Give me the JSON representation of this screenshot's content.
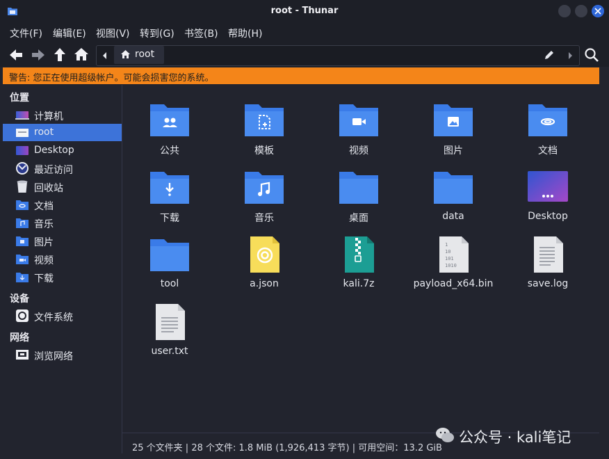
{
  "window": {
    "title": "root - Thunar"
  },
  "menu": [
    {
      "label": "文件(F)"
    },
    {
      "label": "编辑(E)"
    },
    {
      "label": "视图(V)"
    },
    {
      "label": "转到(G)"
    },
    {
      "label": "书签(B)"
    },
    {
      "label": "帮助(H)"
    }
  ],
  "path": {
    "current": "root"
  },
  "warning": "警告: 您正在使用超级帐户。可能会损害您的系统。",
  "sidebar": {
    "places_title": "位置",
    "places": [
      {
        "label": "计算机",
        "icon": "computer-icon"
      },
      {
        "label": "root",
        "icon": "home-folder-icon",
        "selected": true
      },
      {
        "label": "Desktop",
        "icon": "desktop-icon"
      },
      {
        "label": "最近访问",
        "icon": "recent-icon"
      },
      {
        "label": "回收站",
        "icon": "trash-icon"
      },
      {
        "label": "文档",
        "icon": "documents-folder-icon"
      },
      {
        "label": "音乐",
        "icon": "music-folder-icon"
      },
      {
        "label": "图片",
        "icon": "pictures-folder-icon"
      },
      {
        "label": "视频",
        "icon": "videos-folder-icon"
      },
      {
        "label": "下载",
        "icon": "downloads-folder-icon"
      }
    ],
    "devices_title": "设备",
    "devices": [
      {
        "label": "文件系统",
        "icon": "drive-icon"
      }
    ],
    "network_title": "网络",
    "network": [
      {
        "label": "浏览网络",
        "icon": "network-icon"
      }
    ]
  },
  "files": [
    {
      "name": "公共",
      "icon": "public-folder-icon"
    },
    {
      "name": "模板",
      "icon": "templates-folder-icon"
    },
    {
      "name": "视频",
      "icon": "videos-folder-icon"
    },
    {
      "name": "图片",
      "icon": "pictures-folder-icon"
    },
    {
      "name": "文档",
      "icon": "documents-folder-icon"
    },
    {
      "name": "下载",
      "icon": "downloads-folder-icon"
    },
    {
      "name": "音乐",
      "icon": "music-folder-icon"
    },
    {
      "name": "桌面",
      "icon": "folder-icon"
    },
    {
      "name": "data",
      "icon": "folder-icon"
    },
    {
      "name": "Desktop",
      "icon": "desktop-icon"
    },
    {
      "name": "tool",
      "icon": "folder-icon"
    },
    {
      "name": "a.json",
      "icon": "json-file-icon"
    },
    {
      "name": "kali.7z",
      "icon": "archive-file-icon"
    },
    {
      "name": "payload_x64.bin",
      "icon": "binary-file-icon"
    },
    {
      "name": "save.log",
      "icon": "log-file-icon"
    },
    {
      "name": "user.txt",
      "icon": "text-file-icon"
    }
  ],
  "status": "25 个文件夹 | 28 个文件: 1.8 MiB (1,926,413 字节) | 可用空间：13.2 GiB",
  "watermark": "公众号 · kali笔记",
  "colors": {
    "accent": "#3d73d9",
    "warning": "#f48519",
    "folder": "#3a7be8"
  }
}
